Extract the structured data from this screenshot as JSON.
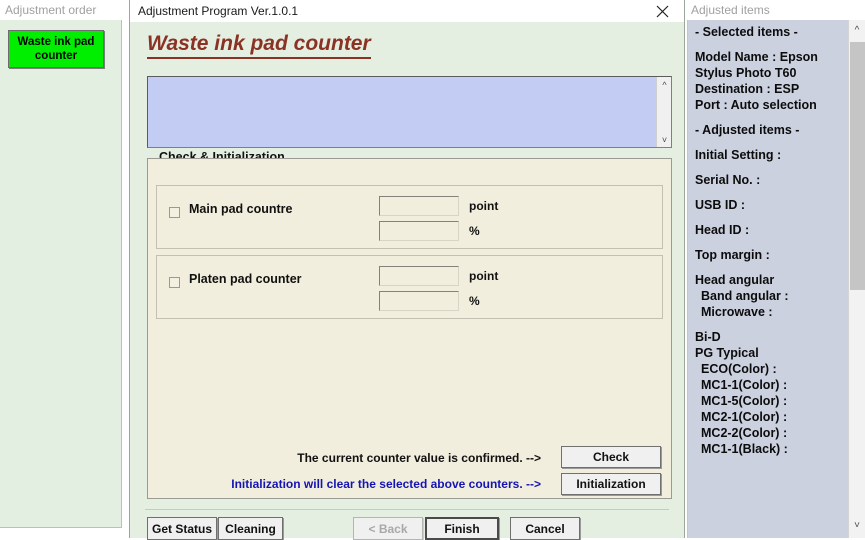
{
  "sidebar": {
    "header": "Adjustment order",
    "order_button": "Waste ink pad counter"
  },
  "window": {
    "title": "Adjustment Program Ver.1.0.1",
    "close_icon": "close-icon",
    "page_title": "Waste ink pad counter",
    "log_value": "",
    "group": {
      "legend": "Check & Initialization",
      "rows": [
        {
          "label": "Main pad countre",
          "checked": false,
          "point_value": "",
          "point_unit": "point",
          "percent_value": "",
          "percent_unit": "%"
        },
        {
          "label": "Platen pad counter",
          "checked": false,
          "point_value": "",
          "point_unit": "point",
          "percent_value": "",
          "percent_unit": "%"
        }
      ],
      "confirm_text": "The current counter value is confirmed. -->",
      "initialization_text": "Initialization will clear the selected above counters. -->",
      "check_button": "Check",
      "initialization_button": "Initialization"
    },
    "footer": {
      "get_status": "Get Status",
      "cleaning": "Cleaning",
      "back": "< Back",
      "finish": "Finish",
      "cancel": "Cancel"
    }
  },
  "right_panel": {
    "header": "Adjusted items",
    "lines": [
      "- Selected items -",
      "Model Name : Epson",
      "Stylus Photo T60",
      "Destination : ESP",
      "Port : Auto selection",
      "- Adjusted items -",
      "Initial Setting :",
      "Serial No. :",
      "USB ID :",
      "Head ID :",
      "Top margin :",
      "Head angular",
      "Band angular :",
      "Microwave :",
      "Bi-D",
      "PG Typical",
      "ECO(Color)  :",
      "MC1-1(Color) :",
      "MC1-5(Color) :",
      "MC2-1(Color) :",
      "MC2-2(Color) :",
      "MC1-1(Black) :"
    ]
  },
  "colors": {
    "accent_green": "#00ef00",
    "title_maroon": "#8a3324",
    "info_blue": "#1414b4",
    "sidebar_bg": "#e3efe1",
    "log_bg": "#c3cdf4",
    "group_bg": "#f1eedd",
    "right_panel_bg": "#ccd1e0"
  }
}
